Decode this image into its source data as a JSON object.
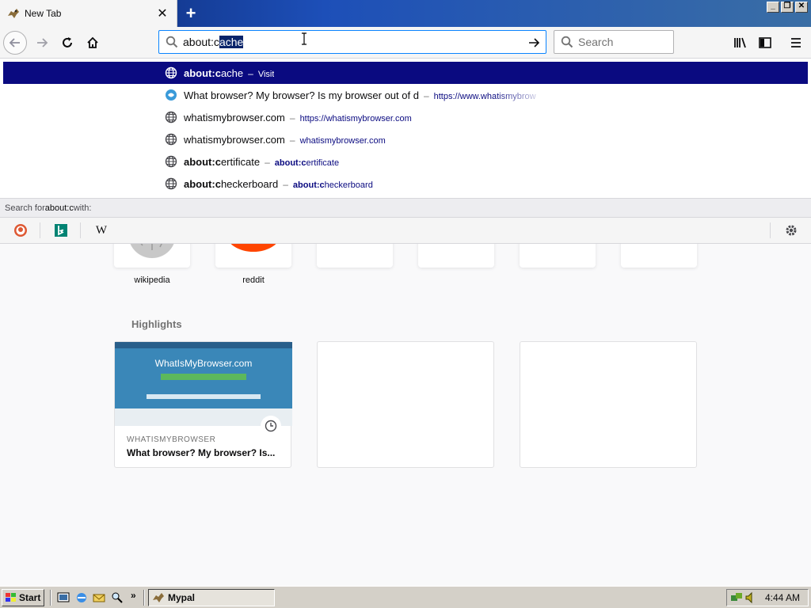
{
  "tab": {
    "title": "New Tab",
    "close_icon": "close-icon"
  },
  "urlbar": {
    "typed": "about:c",
    "completion": "ache"
  },
  "searchbar": {
    "placeholder": "Search"
  },
  "suggestions": [
    {
      "bold": "about:c",
      "rest": "ache",
      "sep": "–",
      "url": "Visit",
      "icon": "globe-icon"
    },
    {
      "bold": "",
      "rest": "What browser? My browser? Is my browser out of d",
      "sep": "–",
      "url": "https://www.whatismybrow",
      "icon": "whatismybrowser-favicon"
    },
    {
      "bold": "",
      "rest": "whatismybrowser.com",
      "sep": "–",
      "url": "https://whatismybrowser.com",
      "icon": "globe-icon"
    },
    {
      "bold": "",
      "rest": "whatismybrowser.com",
      "sep": "–",
      "url": "whatismybrowser.com",
      "icon": "globe-icon"
    },
    {
      "bold": "about:c",
      "rest": "ertificate",
      "sep": "–",
      "url_bold": "about:c",
      "url": "ertificate",
      "icon": "globe-icon"
    },
    {
      "bold": "about:c",
      "rest": "heckerboard",
      "sep": "–",
      "url_bold": "about:c",
      "url": "heckerboard",
      "icon": "globe-icon"
    }
  ],
  "oneoff": {
    "prefix": "Search for ",
    "query": "about:c",
    "suffix": " with:"
  },
  "engines": [
    "duckduckgo-icon",
    "bing-icon",
    "wikipedia-icon"
  ],
  "topsites": [
    {
      "label": "wikipedia"
    },
    {
      "label": "reddit"
    }
  ],
  "highlights": {
    "title": "Highlights",
    "card": {
      "screenshot_title": "WhatIsMyBrowser.com",
      "context": "WHATISMYBROWSER",
      "title": "What browser? My browser? Is..."
    }
  },
  "taskbar": {
    "start": "Start",
    "task": "Mypal",
    "time": "4:44 AM"
  },
  "colors": {
    "selection": "#0a0a80",
    "accent": "#0a84ff"
  }
}
